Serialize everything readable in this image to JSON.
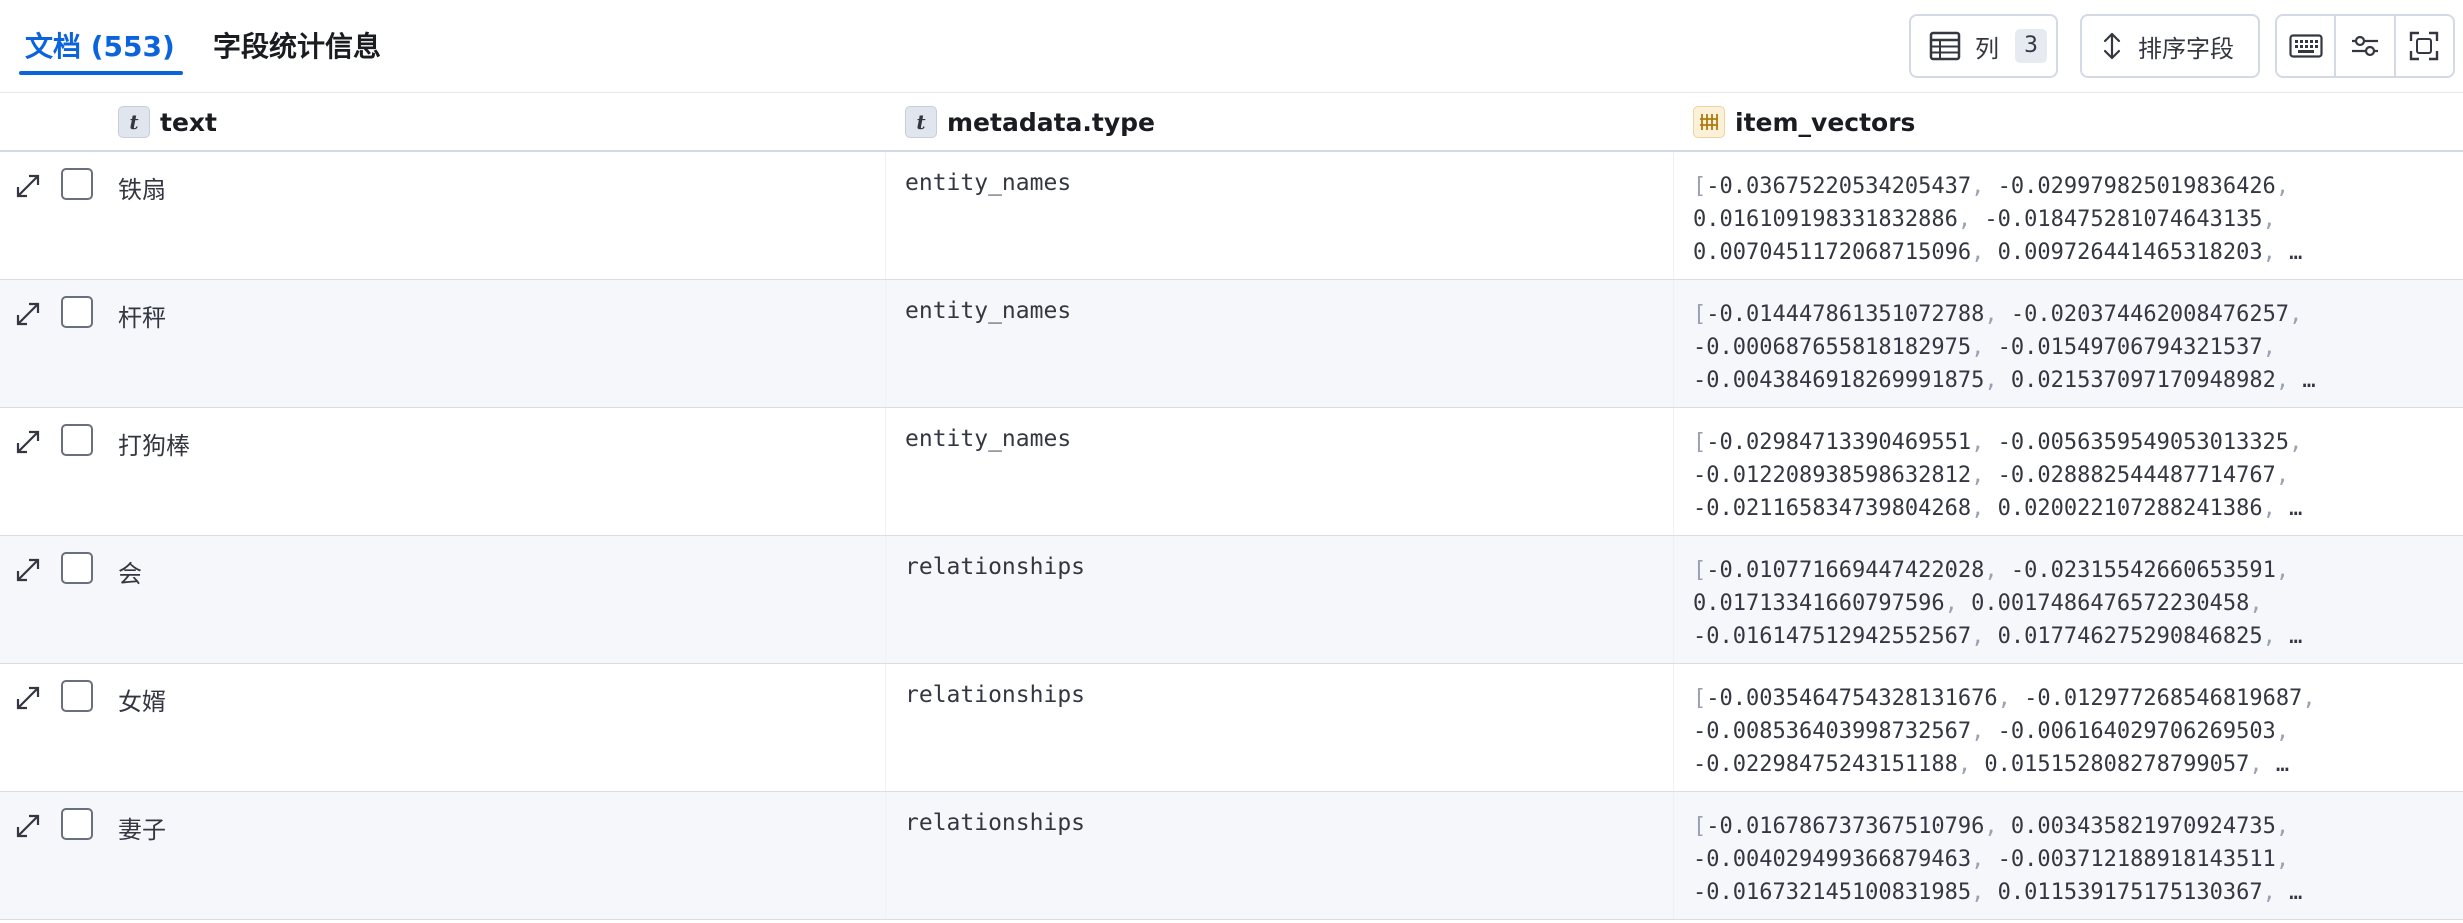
{
  "tabs": {
    "documents": "文档 (553)",
    "field_statistics": "字段统计信息"
  },
  "toolbar": {
    "columns_label": "列",
    "columns_count": "3",
    "sort_label": "排序字段",
    "icons": [
      "keyboard-icon",
      "display-options-icon",
      "fullscreen-icon"
    ]
  },
  "columns": {
    "text": "text",
    "type": "metadata.type",
    "vectors": "item_vectors"
  },
  "rows": [
    {
      "text": "铁扇",
      "type": "entity_names",
      "v1": "-0.03675220534205437",
      "v2": "-0.029979825019836426",
      "v3": "0.016109198331832886",
      "v4": "-0.018475281074643135",
      "v5": "0.0070451172068715096",
      "v6": "0.009726441465318203"
    },
    {
      "text": "杆秤",
      "type": "entity_names",
      "v1": "-0.014447861351072788",
      "v2": "-0.020374462008476257",
      "v3": "-0.000687655818182975",
      "v4": "-0.01549706794321537",
      "v5": "-0.0043846918269991875",
      "v6": "0.021537097170948982"
    },
    {
      "text": "打狗棒",
      "type": "entity_names",
      "v1": "-0.02984713390469551",
      "v2": "-0.0056359549053013325",
      "v3": "-0.012208938598632812",
      "v4": "-0.028882544487714767",
      "v5": "-0.021165834739804268",
      "v6": "0.020022107288241386"
    },
    {
      "text": "会",
      "type": "relationships",
      "v1": "-0.010771669447422028",
      "v2": "-0.02315542660653591",
      "v3": "0.01713341660797596",
      "v4": "0.0017486476572230458",
      "v5": "-0.016147512942552567",
      "v6": "0.017746275290846825"
    },
    {
      "text": "女婿",
      "type": "relationships",
      "v1": "-0.0035464754328131676",
      "v2": "-0.012977268546819687",
      "v3": "-0.008536403998732567",
      "v4": "-0.006164029706269503",
      "v5": "-0.02298475243151188",
      "v6": "0.015152808278799057"
    },
    {
      "text": "妻子",
      "type": "relationships",
      "v1": "-0.016786737367510796",
      "v2": "0.003435821970924735",
      "v3": "-0.004029499366879463",
      "v4": "-0.003712188918143511",
      "v5": "-0.016732145100831985",
      "v6": "0.011539175175130367"
    }
  ],
  "glyphs": {
    "open_bracket": "[",
    "comma": ",",
    "ellipsis": "…",
    "type_token": "t"
  }
}
